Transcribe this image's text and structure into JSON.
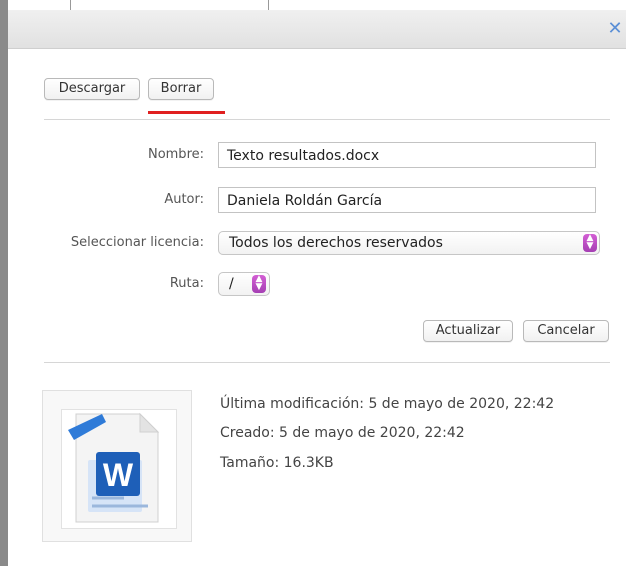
{
  "toolbar": {
    "download_label": "Descargar",
    "delete_label": "Borrar"
  },
  "form": {
    "name_label": "Nombre:",
    "name_value": "Texto resultados.docx",
    "author_label": "Autor:",
    "author_value": "Daniela  Roldán García",
    "license_label": "Seleccionar licencia:",
    "license_value": "Todos los derechos reservados",
    "path_label": "Ruta:",
    "path_value": "/"
  },
  "actions": {
    "update_label": "Actualizar",
    "cancel_label": "Cancelar"
  },
  "file_info": {
    "modified": "Última modificación: 5 de mayo de 2020, 22:42",
    "created": "Creado: 5 de mayo de 2020, 22:42",
    "size": "Tamaño: 16.3KB"
  },
  "icons": {
    "close": "close-icon",
    "file": "word-document-icon"
  },
  "colors": {
    "accent": "#5b8fd6",
    "stepper": "#b64bc2",
    "highlight": "#e02020"
  }
}
